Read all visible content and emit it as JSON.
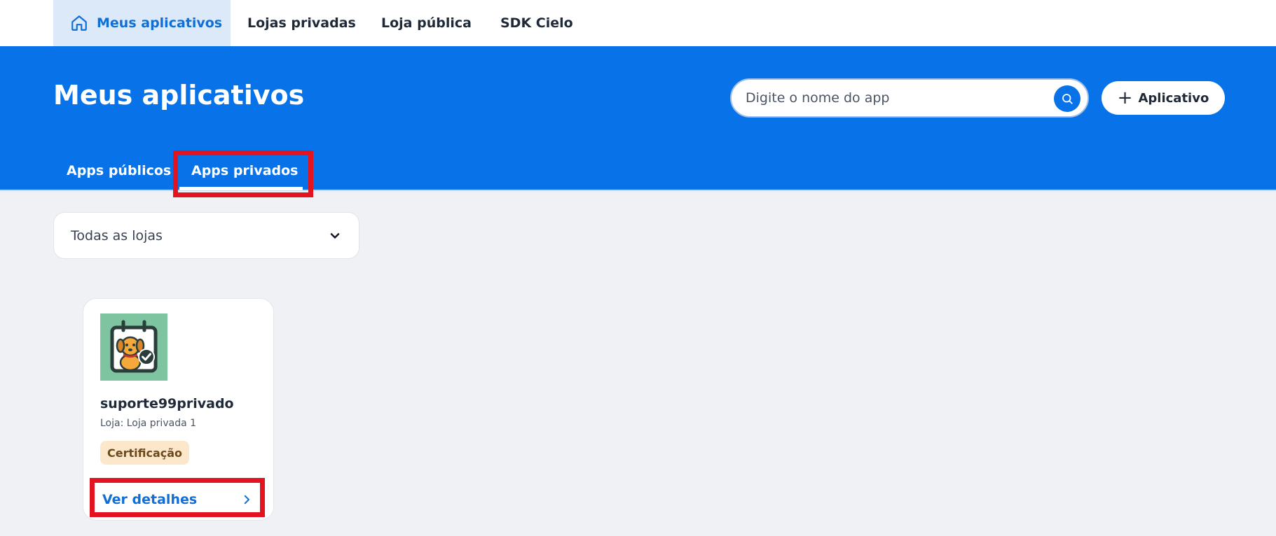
{
  "topnav": {
    "items": [
      {
        "label": "Meus aplicativos",
        "icon": "home-icon",
        "active": true
      },
      {
        "label": "Lojas privadas"
      },
      {
        "label": "Loja pública"
      },
      {
        "label": "SDK Cielo"
      }
    ]
  },
  "hero": {
    "title": "Meus aplicativos",
    "search_placeholder": "Digite o nome do app",
    "add_button_label": "Aplicativo",
    "tabs": [
      {
        "label": "Apps públicos"
      },
      {
        "label": "Apps privados",
        "active": true
      }
    ]
  },
  "filter": {
    "selected": "Todas as lojas"
  },
  "apps": [
    {
      "name": "suporte99privado",
      "store": "Loja: Loja privada 1",
      "status": "Certificação",
      "details_label": "Ver detalhes"
    }
  ],
  "colors": {
    "primary": "#0873e9",
    "highlight": "#e3141f",
    "badge_bg": "#fde7cb",
    "icon_bg": "#7ec4a0"
  }
}
